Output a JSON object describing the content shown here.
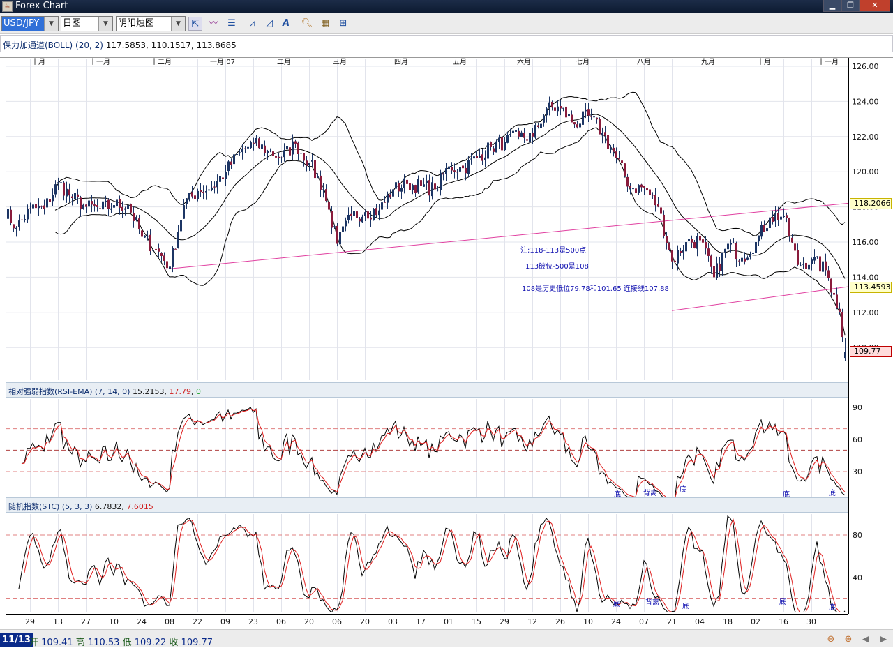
{
  "window": {
    "title": "Forex Chart",
    "controls": [
      "minimize",
      "restore",
      "close"
    ]
  },
  "toolbar": {
    "symbol": "USD/JPY",
    "period": "日图",
    "chart_type": "阴阳烛图",
    "icons": [
      "cursor-arrow-icon",
      "indicator-icon",
      "panel-icon",
      "line-study-icon",
      "area-study-icon",
      "text-tool-icon",
      "zoom-icon",
      "export-icon",
      "layout-icon"
    ]
  },
  "indicator_bar": {
    "name": "保力加通道(BOLL) (20, 2)",
    "values": "117.5853, 110.1517, 113.8685"
  },
  "rsi_panel": {
    "name": "相对强弱指数(RSI-EMA) (7, 14, 0)",
    "v1": "15.2153",
    "v2": "17.79",
    "v3": "0",
    "ticks": [
      "90",
      "60",
      "30"
    ]
  },
  "stc_panel": {
    "name": "随机指数(STC) (5, 3, 3)",
    "v1": "6.7832",
    "v2": "7.6015",
    "ticks": [
      "80",
      "40"
    ]
  },
  "annotations": {
    "a1": "注;118-113是500点",
    "a2": "113破位-500是108",
    "a3": "108是历史低位79.78和101.65 连接线107.88",
    "rsi_marks": [
      "底",
      "背离",
      "底",
      "底",
      "底"
    ],
    "stc_marks": [
      "底",
      "背离",
      "底",
      "底",
      "底"
    ]
  },
  "price_labels": {
    "upper_trend": "118.2066",
    "lower_trend": "113.4593",
    "last": "109.77"
  },
  "status": {
    "date": "11/13",
    "open_label": "开",
    "open": "109.41",
    "high_label": "高",
    "high": "110.53",
    "low_label": "低",
    "low": "109.22",
    "close_label": "收",
    "close": "109.77"
  },
  "colors": {
    "up": "#1c3564",
    "down": "#8a1c3c",
    "trend": "#e040a0",
    "rsi_main": "#000000",
    "rsi_signal": "#e02020",
    "dash": "#e08080"
  },
  "chart_data": {
    "type": "candlestick",
    "symbol": "USD/JPY",
    "y_ticks": [
      126,
      124,
      122,
      120,
      118,
      116,
      114,
      112,
      110
    ],
    "ylim": [
      108.6,
      126.4
    ],
    "month_labels": [
      {
        "date": "2006-10-02",
        "label": "十月"
      },
      {
        "date": "2006-11-01",
        "label": "十一月"
      },
      {
        "date": "2006-12-01",
        "label": "十二月"
      },
      {
        "date": "2007-01-02",
        "label": "一月 07"
      },
      {
        "date": "2007-02-01",
        "label": "二月"
      },
      {
        "date": "2007-03-01",
        "label": "三月"
      },
      {
        "date": "2007-04-02",
        "label": "四月"
      },
      {
        "date": "2007-05-01",
        "label": "五月"
      },
      {
        "date": "2007-06-01",
        "label": "六月"
      },
      {
        "date": "2007-07-02",
        "label": "七月"
      },
      {
        "date": "2007-08-01",
        "label": "八月"
      },
      {
        "date": "2007-09-03",
        "label": "九月"
      },
      {
        "date": "2007-10-01",
        "label": "十月"
      },
      {
        "date": "2007-11-01",
        "label": "十一月"
      }
    ],
    "x_ticks": [
      {
        "date": "2006-09-29",
        "label": "29"
      },
      {
        "date": "2006-10-13",
        "label": "13"
      },
      {
        "date": "2006-10-27",
        "label": "27"
      },
      {
        "date": "2006-11-10",
        "label": "10"
      },
      {
        "date": "2006-11-24",
        "label": "24"
      },
      {
        "date": "2006-12-08",
        "label": "08"
      },
      {
        "date": "2006-12-22",
        "label": "22"
      },
      {
        "date": "2007-01-05",
        "label": "09"
      },
      {
        "date": "2007-01-19",
        "label": "23"
      },
      {
        "date": "2007-02-02",
        "label": "06"
      },
      {
        "date": "2007-02-16",
        "label": "20"
      },
      {
        "date": "2007-03-02",
        "label": "06"
      },
      {
        "date": "2007-03-16",
        "label": "20"
      },
      {
        "date": "2007-03-30",
        "label": "03"
      },
      {
        "date": "2007-04-13",
        "label": "17"
      },
      {
        "date": "2007-04-27",
        "label": "01"
      },
      {
        "date": "2007-05-11",
        "label": "15"
      },
      {
        "date": "2007-05-25",
        "label": "29"
      },
      {
        "date": "2007-06-08",
        "label": "12"
      },
      {
        "date": "2007-06-22",
        "label": "26"
      },
      {
        "date": "2007-07-06",
        "label": "10"
      },
      {
        "date": "2007-07-20",
        "label": "24"
      },
      {
        "date": "2007-08-03",
        "label": "07"
      },
      {
        "date": "2007-08-17",
        "label": "21"
      },
      {
        "date": "2007-08-31",
        "label": "04"
      },
      {
        "date": "2007-09-14",
        "label": "18"
      },
      {
        "date": "2007-09-28",
        "label": "02"
      },
      {
        "date": "2007-10-12",
        "label": "16"
      },
      {
        "date": "2007-10-26",
        "label": "30"
      }
    ],
    "closes": [
      [
        "2006-09-15",
        118.0
      ],
      [
        "2006-09-22",
        116.8
      ],
      [
        "2006-09-29",
        117.9
      ],
      [
        "2006-10-06",
        117.9
      ],
      [
        "2006-10-13",
        119.4
      ],
      [
        "2006-10-20",
        118.5
      ],
      [
        "2006-10-27",
        118.0
      ],
      [
        "2006-11-03",
        117.9
      ],
      [
        "2006-11-10",
        118.1
      ],
      [
        "2006-11-17",
        118.1
      ],
      [
        "2006-11-24",
        116.3
      ],
      [
        "2006-12-01",
        115.6
      ],
      [
        "2006-12-08",
        114.6
      ],
      [
        "2006-12-15",
        118.1
      ],
      [
        "2006-12-22",
        118.9
      ],
      [
        "2006-12-29",
        119.1
      ],
      [
        "2007-01-05",
        120.0
      ],
      [
        "2007-01-12",
        121.1
      ],
      [
        "2007-01-19",
        121.6
      ],
      [
        "2007-01-26",
        121.2
      ],
      [
        "2007-02-02",
        120.8
      ],
      [
        "2007-02-09",
        121.6
      ],
      [
        "2007-02-16",
        120.5
      ],
      [
        "2007-02-23",
        119.0
      ],
      [
        "2007-03-02",
        115.9
      ],
      [
        "2007-03-09",
        117.5
      ],
      [
        "2007-03-16",
        117.7
      ],
      [
        "2007-03-23",
        117.8
      ],
      [
        "2007-03-30",
        119.0
      ],
      [
        "2007-04-06",
        119.3
      ],
      [
        "2007-04-13",
        119.2
      ],
      [
        "2007-04-20",
        119.0
      ],
      [
        "2007-04-27",
        120.3
      ],
      [
        "2007-05-04",
        120.2
      ],
      [
        "2007-05-11",
        120.8
      ],
      [
        "2007-05-18",
        121.4
      ],
      [
        "2007-05-25",
        121.7
      ],
      [
        "2007-06-01",
        122.0
      ],
      [
        "2007-06-08",
        122.0
      ],
      [
        "2007-06-15",
        123.6
      ],
      [
        "2007-06-22",
        123.6
      ],
      [
        "2007-06-29",
        122.7
      ],
      [
        "2007-07-06",
        123.2
      ],
      [
        "2007-07-13",
        122.2
      ],
      [
        "2007-07-20",
        120.8
      ],
      [
        "2007-07-27",
        119.1
      ],
      [
        "2007-08-03",
        119.1
      ],
      [
        "2007-08-10",
        118.0
      ],
      [
        "2007-08-17",
        114.9
      ],
      [
        "2007-08-24",
        116.0
      ],
      [
        "2007-08-31",
        116.1
      ],
      [
        "2007-09-07",
        114.0
      ],
      [
        "2007-09-14",
        115.9
      ],
      [
        "2007-09-21",
        115.1
      ],
      [
        "2007-09-28",
        116.0
      ],
      [
        "2007-10-05",
        117.4
      ],
      [
        "2007-10-12",
        117.5
      ],
      [
        "2007-10-19",
        114.7
      ],
      [
        "2007-10-26",
        115.0
      ],
      [
        "2007-11-02",
        114.4
      ],
      [
        "2007-11-07",
        113.0
      ],
      [
        "2007-11-09",
        112.0
      ],
      [
        "2007-11-12",
        110.6
      ],
      [
        "2007-11-13",
        109.77
      ]
    ],
    "last_bar": {
      "date": "2007-11-13",
      "open": 109.41,
      "high": 110.53,
      "low": 109.22,
      "close": 109.77
    },
    "overlays": {
      "bollinger": {
        "period": 20,
        "k": 2
      }
    },
    "trendlines": [
      {
        "from": [
          "2006-12-06",
          114.45
        ],
        "to": [
          "2007-11-13",
          118.2066
        ]
      },
      {
        "from": [
          "2007-08-17",
          112.1
        ],
        "to": [
          "2007-11-13",
          113.4593
        ]
      }
    ],
    "rsi": {
      "period": 7,
      "signal": 14,
      "ylim": [
        6,
        98
      ],
      "levels": [
        70,
        50,
        30
      ]
    },
    "stc": {
      "k": 5,
      "slow": 3,
      "d": 3,
      "ylim": [
        7,
        100
      ],
      "levels": [
        80,
        20
      ]
    }
  }
}
